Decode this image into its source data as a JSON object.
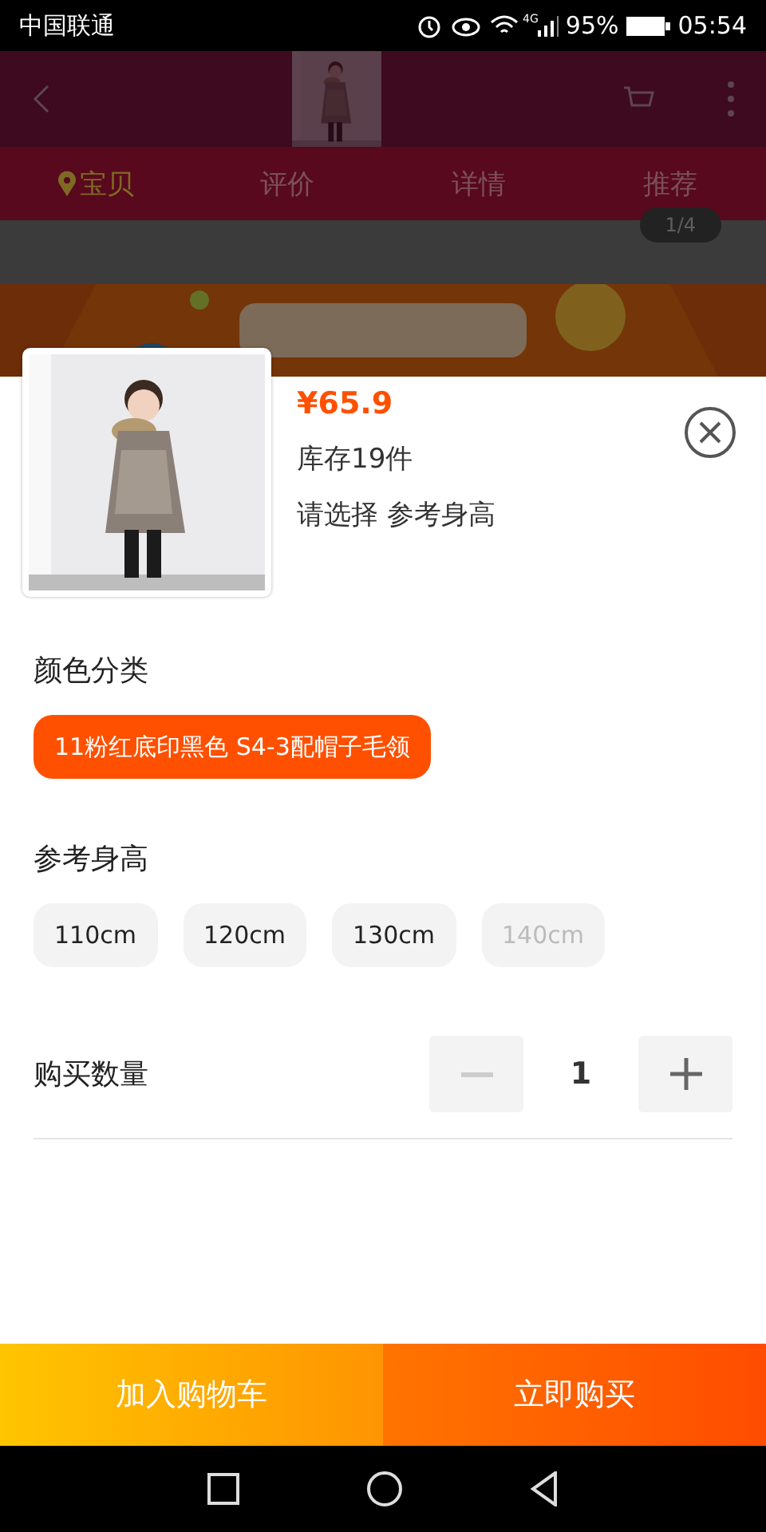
{
  "status_bar": {
    "carrier": "中国联通",
    "network": "4G",
    "battery": "95%",
    "time": "05:54"
  },
  "background_page": {
    "tabs": [
      {
        "label": "宝贝",
        "selected": true
      },
      {
        "label": "评价",
        "selected": false
      },
      {
        "label": "详情",
        "selected": false
      },
      {
        "label": "推荐",
        "selected": false
      }
    ],
    "image_counter": "1/4"
  },
  "sku_sheet": {
    "price": "¥65.9",
    "stock": "库存19件",
    "prompt": "请选择 参考身高",
    "groups": [
      {
        "title": "颜色分类",
        "options": [
          {
            "label": "11粉红底印黑色 S4-3配帽子毛领",
            "selected": true,
            "disabled": false
          }
        ]
      },
      {
        "title": "参考身高",
        "options": [
          {
            "label": "110cm",
            "selected": false,
            "disabled": false
          },
          {
            "label": "120cm",
            "selected": false,
            "disabled": false
          },
          {
            "label": "130cm",
            "selected": false,
            "disabled": false
          },
          {
            "label": "140cm",
            "selected": false,
            "disabled": true
          }
        ]
      }
    ],
    "quantity": {
      "label": "购买数量",
      "value": "1",
      "minus_disabled": true,
      "plus_disabled": false
    }
  },
  "buttons": [
    {
      "label": "加入购物车",
      "kind": "cart"
    },
    {
      "label": "立即购买",
      "kind": "buy"
    }
  ]
}
